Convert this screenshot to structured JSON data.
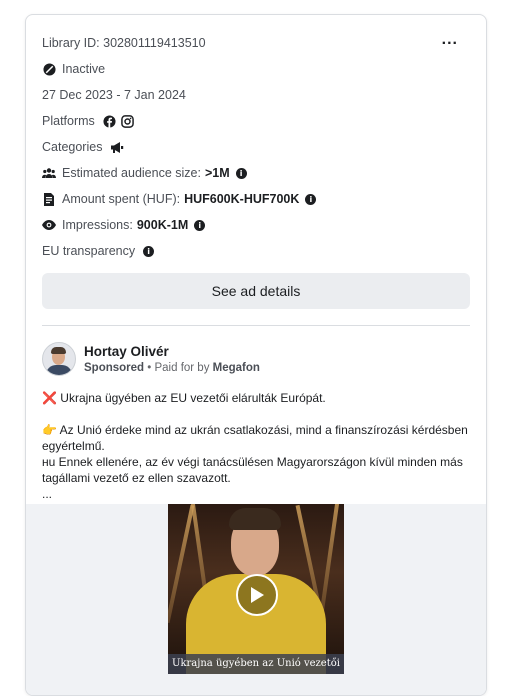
{
  "ad": {
    "library_id": "Library ID: 302801119413510",
    "status": "Inactive",
    "date_range": "27 Dec 2023 - 7 Jan 2024",
    "platforms_label": "Platforms",
    "categories_label": "Categories",
    "audience_label": "Estimated audience size:",
    "audience_value": ">1M",
    "amount_label": "Amount spent (HUF):",
    "amount_value": "HUF600K-HUF700K",
    "impressions_label": "Impressions:",
    "impressions_value": "900K-1M",
    "eu_label": "EU transparency",
    "see_details": "See ad details",
    "more_menu": "..."
  },
  "post": {
    "author": "Hortay Olivér",
    "sponsored": "Sponsored",
    "paid_by_prefix": " • Paid for by ",
    "paid_by": "Megafon",
    "line1": "❌ Ukrajna ügyében az EU vezetői elárulták Európát.",
    "line2": "👉 Az Unió érdeke mind az ukrán csatlakozási, mind a finanszírozási kérdésben egyértelmű.",
    "line3": "ʜu Ennek ellenére, az év végi tanácsülésen Magyarországon kívül minden más tagállami vezető ez ellen szavazott.",
    "line4": "...",
    "video_caption": "Ukrajna ügyében az Unió vezetői"
  },
  "icons": {
    "status": "inactive-icon",
    "platforms": [
      "facebook-icon",
      "instagram-icon"
    ],
    "categories": "megaphone-icon",
    "audience": "people-icon",
    "amount": "receipt-icon",
    "impressions": "eye-icon",
    "info": "info-icon",
    "play": "play-icon"
  }
}
